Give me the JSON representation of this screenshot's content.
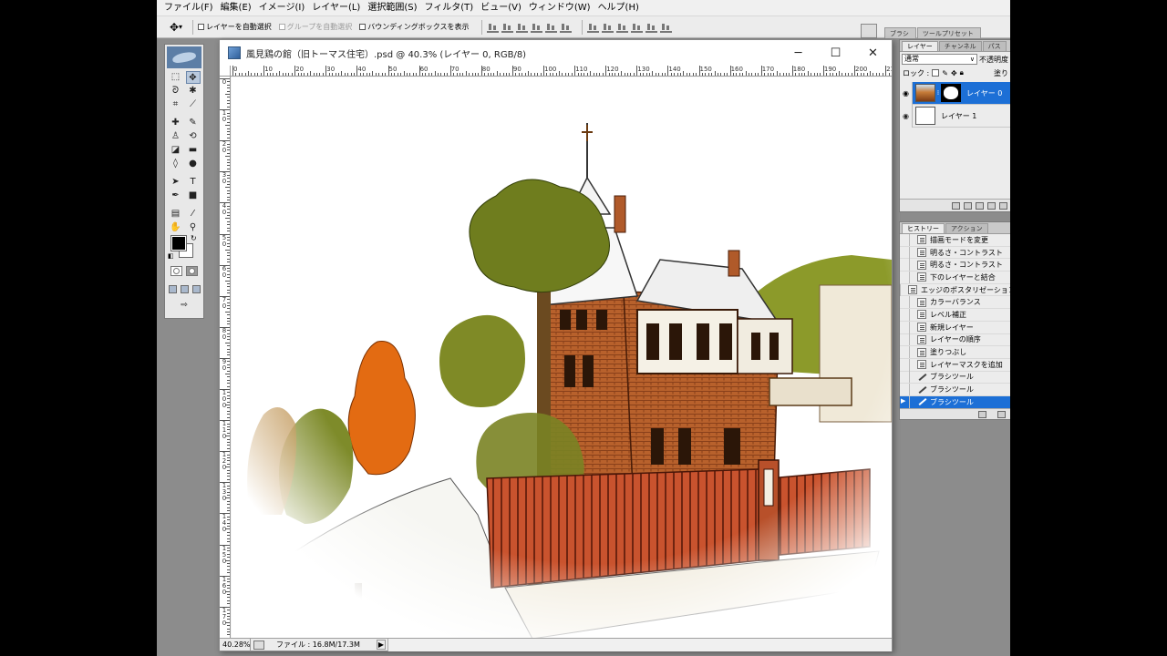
{
  "menu": [
    "ファイル(F)",
    "編集(E)",
    "イメージ(I)",
    "レイヤー(L)",
    "選択範囲(S)",
    "フィルタ(T)",
    "ビュー(V)",
    "ウィンドウ(W)",
    "ヘルプ(H)"
  ],
  "options_bar": {
    "tool_arrow": "▾",
    "auto_select_layer": "レイヤーを自動選択",
    "auto_select_group": "グループを自動選択",
    "show_bounding_box": "バウンディングボックスを表示"
  },
  "palette_well": [
    "ブラシ",
    "ツールプリセット"
  ],
  "document": {
    "title": "風見鶏の館（旧トーマス住宅）.psd @ 40.3% (レイヤー 0, RGB/8)",
    "minimize": "─",
    "maximize": "☐",
    "close": "✕",
    "zoom": "40.28%",
    "file_info": "ファイル : 16.8M/17.3M",
    "status_arrow": "▶"
  },
  "ruler_h": [
    "0",
    "10",
    "20",
    "30",
    "40",
    "50",
    "60",
    "70",
    "80",
    "90",
    "100",
    "110",
    "120",
    "130",
    "140",
    "150",
    "160",
    "170",
    "180",
    "190",
    "200",
    "210"
  ],
  "ruler_v": [
    "0",
    "1 0",
    "2 0",
    "3 0",
    "4 0",
    "5 0",
    "6 0",
    "7 0",
    "8 0",
    "9 0",
    "1 0 0",
    "1 1 0",
    "1 2 0",
    "1 3 0",
    "1 4 0",
    "1 5 0",
    "1 6 0",
    "1 7 0",
    "1 8 0"
  ],
  "layers_panel": {
    "tabs": [
      "レイヤー",
      "チャンネル",
      "パス"
    ],
    "blend_mode": "通常",
    "opacity_label": "不透明度",
    "lock_label": "ロック :",
    "fill_label": "塗り",
    "layers": [
      {
        "name": "レイヤー 0",
        "selected": true
      },
      {
        "name": "レイヤー 1",
        "selected": false
      }
    ]
  },
  "history_panel": {
    "tabs": [
      "ヒストリー",
      "アクション"
    ],
    "items": [
      {
        "label": "描画モードを変更",
        "icon": "doc-icon"
      },
      {
        "label": "明るさ・コントラスト",
        "icon": "doc-icon"
      },
      {
        "label": "明るさ・コントラスト",
        "icon": "doc-icon"
      },
      {
        "label": "下のレイヤーと結合",
        "icon": "doc-icon"
      },
      {
        "label": "エッジのポスタリゼーション",
        "icon": "doc-icon"
      },
      {
        "label": "カラーバランス",
        "icon": "doc-icon"
      },
      {
        "label": "レベル補正",
        "icon": "doc-icon"
      },
      {
        "label": "新規レイヤー",
        "icon": "doc-icon"
      },
      {
        "label": "レイヤーの順序",
        "icon": "doc-icon"
      },
      {
        "label": "塗りつぶし",
        "icon": "doc-icon"
      },
      {
        "label": "レイヤーマスクを追加",
        "icon": "doc-icon"
      },
      {
        "label": "ブラシツール",
        "icon": "brush-icon"
      },
      {
        "label": "ブラシツール",
        "icon": "brush-icon"
      },
      {
        "label": "ブラシツール",
        "icon": "brush-icon"
      }
    ],
    "selected_index": 13
  },
  "colors": {
    "foreground": "#000000",
    "background": "#ffffff",
    "selection_blue": "#1c6fd6",
    "brick": "#b5582a",
    "fence": "#c0442a"
  }
}
